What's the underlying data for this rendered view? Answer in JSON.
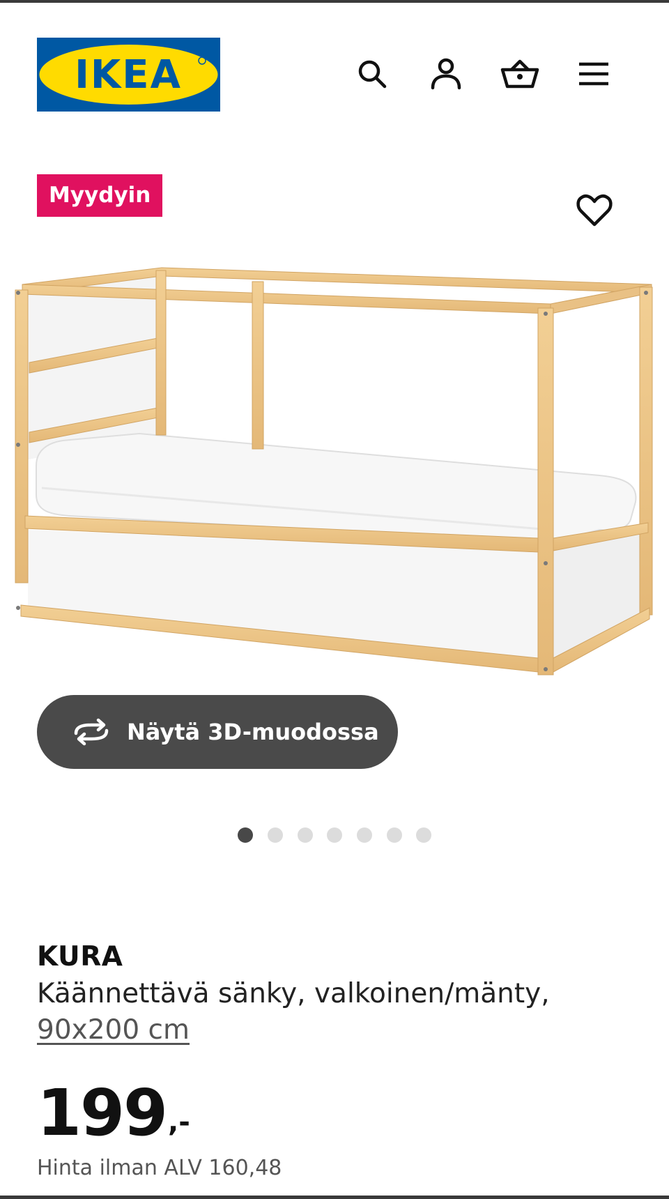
{
  "header": {
    "logo_text": "IKEA",
    "icons": [
      "search-icon",
      "account-icon",
      "basket-icon",
      "menu-icon"
    ],
    "brand_blue": "#0058a3",
    "brand_yellow": "#ffdb00"
  },
  "badge": {
    "label": "Myydyin",
    "color": "#e0115f"
  },
  "favourite": {
    "icon": "heart-outline-icon"
  },
  "view_3d": {
    "label": "Näytä 3D-muodossa",
    "icon": "rotate-3d-icon"
  },
  "carousel": {
    "total": 7,
    "active_index": 0
  },
  "product": {
    "name": "KURA",
    "description": "Käännettävä sänky, valkoinen/mänty,",
    "size": "90x200 cm",
    "price": "199",
    "price_suffix": ",-",
    "price_without_vat": "Hinta ilman ALV 160,48"
  }
}
